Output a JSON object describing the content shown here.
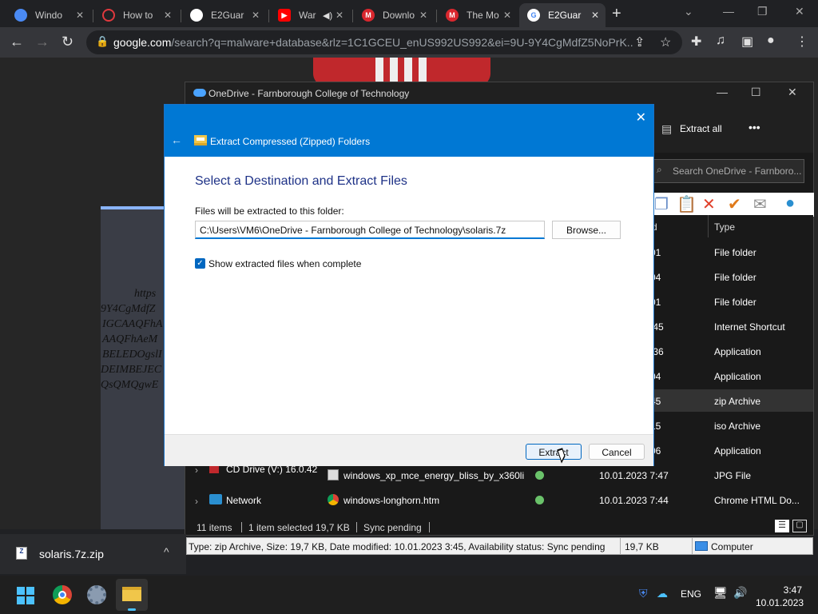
{
  "browser": {
    "tabs": [
      {
        "title": "Windo",
        "icon": "chrome-icon",
        "color": "#4a8af4"
      },
      {
        "title": "How to",
        "icon": "opera-icon",
        "color": "#e0393e"
      },
      {
        "title": "E2Guar",
        "icon": "github-icon",
        "color": "#ffffff"
      },
      {
        "title": "War",
        "icon": "youtube-icon",
        "color": "#ff0000"
      },
      {
        "title": "Downlo",
        "icon": "mega-icon",
        "color": "#d9272e"
      },
      {
        "title": "The Mo",
        "icon": "mega-icon",
        "color": "#d9272e"
      },
      {
        "title": "E2Guar",
        "icon": "google-icon",
        "color": "#4285f4"
      }
    ],
    "new_tab": "+",
    "url_host": "google.com",
    "url_rest": "/search?q=malware+database&rlz=1C1GCEU_enUS992US992&ei=9U-9Y4CgMdfZ5NoPrK..."
  },
  "page_text": [
    "https",
    "9Y4CgMdfZ",
    "IGCAAQFhA",
    "AAQFhAeM",
    "BELEDOgslI",
    "DEIMBEJEC",
    "QsQMQgwE"
  ],
  "explorer": {
    "title": "OneDrive - Farnborough College of Technology",
    "extract_all": "Extract all",
    "more": "•••",
    "search_placeholder": "Search OneDrive - Farnboro...",
    "col_type": "Type",
    "col_modified_partial": "d",
    "rows": [
      {
        "date_partial": "01",
        "type": "File folder"
      },
      {
        "date_partial": "04",
        "type": "File folder"
      },
      {
        "date_partial": "01",
        "type": "File folder"
      },
      {
        "date_partial": ":45",
        "type": "Internet Shortcut"
      },
      {
        "date_partial": ":36",
        "type": "Application"
      },
      {
        "date_partial": "04",
        "type": "Application"
      },
      {
        "date_partial": "45",
        "type": "zip Archive"
      },
      {
        "date_partial": "15",
        "type": "iso Archive"
      },
      {
        "date_partial": "06",
        "type": "Application"
      }
    ],
    "cd_drive": "CD Drive (V:) 16.0.42",
    "network": "Network",
    "file_rows": [
      {
        "name": "windows_xp_mce_energy_bliss_by_x360li...",
        "date": "10.01.2023 7:47",
        "type": "JPG File"
      },
      {
        "name": "windows-longhorn.htm",
        "date": "10.01.2023 7:44",
        "type": "Chrome HTML Do..."
      }
    ],
    "status": {
      "items": "11 items",
      "selected": "1 item selected  19,7 KB",
      "sync": "Sync pending"
    }
  },
  "dialog": {
    "window_title": "Extract Compressed (Zipped) Folders",
    "heading": "Select a Destination and Extract Files",
    "label": "Files will be extracted to this folder:",
    "path": "C:\\Users\\VM6\\OneDrive - Farnborough College of Technology\\solaris.7z",
    "browse": "Browse...",
    "checkbox_label": "Show extracted files when complete",
    "checkbox_checked": true,
    "extract": "Extract",
    "cancel": "Cancel",
    "close": "✕",
    "back": "←"
  },
  "download": {
    "filename": "solaris.7z.zip",
    "chevron": "^"
  },
  "statusbar": {
    "info": "Type: zip Archive, Size: 19,7 KB, Date modified: 10.01.2023 3:45, Availability status: Sync pending",
    "size": "19,7 KB",
    "location": "Computer"
  },
  "taskbar": {
    "lang": "ENG",
    "time": "3:47",
    "date": "10.01.2023"
  }
}
